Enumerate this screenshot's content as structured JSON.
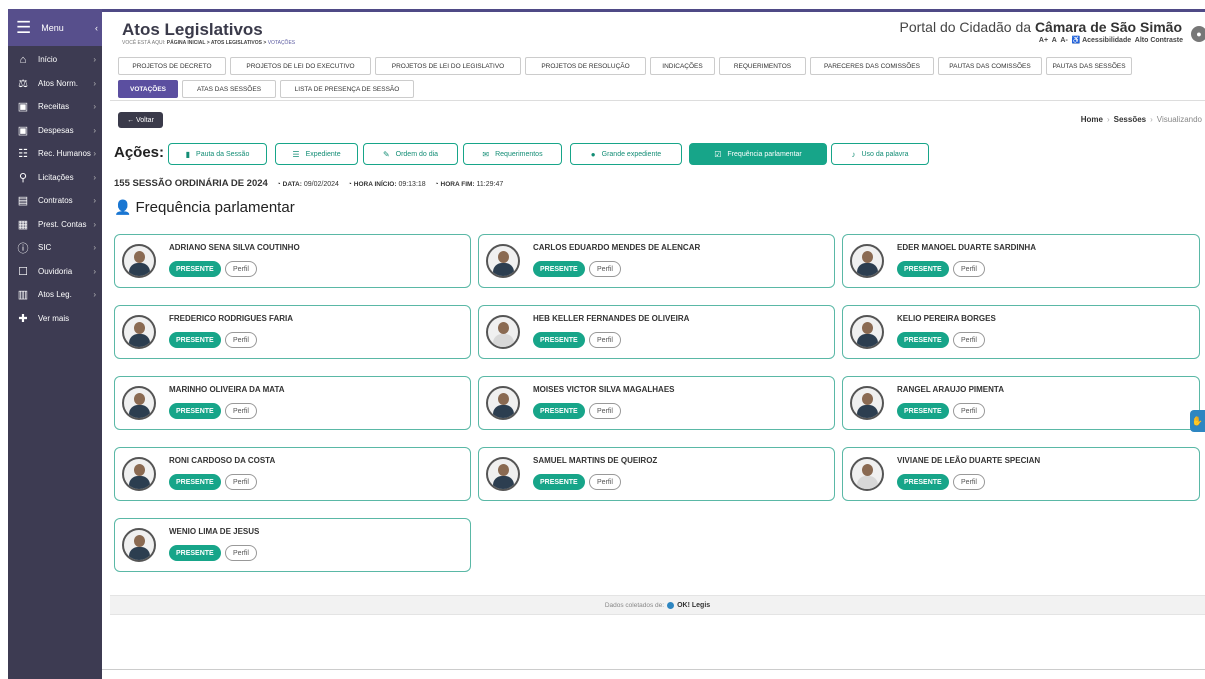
{
  "sidebar": {
    "menu_label": "Menu",
    "items": [
      {
        "label": "Início",
        "icon": "home-icon",
        "glyph": "⌂"
      },
      {
        "label": "Atos Norm.",
        "icon": "scales-icon",
        "glyph": "⚖"
      },
      {
        "label": "Receitas",
        "icon": "money-icon",
        "glyph": "▣"
      },
      {
        "label": "Despesas",
        "icon": "money-out-icon",
        "glyph": "▣"
      },
      {
        "label": "Rec. Humanos",
        "icon": "people-icon",
        "glyph": "☷"
      },
      {
        "label": "Licitações",
        "icon": "handshake-icon",
        "glyph": "⚲"
      },
      {
        "label": "Contratos",
        "icon": "document-icon",
        "glyph": "▤"
      },
      {
        "label": "Prest. Contas",
        "icon": "accounts-icon",
        "glyph": "▦"
      },
      {
        "label": "SIC",
        "icon": "info-icon",
        "glyph": "ⓘ"
      },
      {
        "label": "Ouvidoria",
        "icon": "chat-icon",
        "glyph": "☐"
      },
      {
        "label": "Atos Leg.",
        "icon": "building-icon",
        "glyph": "▥"
      },
      {
        "label": "Ver mais",
        "icon": "plus-icon",
        "glyph": "✚"
      }
    ]
  },
  "header": {
    "title": "Atos Legislativos",
    "breadcrumb_prefix": "VOCÊ ESTÁ AQUI:",
    "breadcrumb_path": "PÁGINA INICIAL > ATOS LEGISLATIVOS >",
    "breadcrumb_current": "VOTAÇÕES",
    "portal_prefix": "Portal do Cidadão da",
    "portal_name": "Câmara de São Simão",
    "font_up": "A+",
    "font_normal": "A",
    "font_down": "A-",
    "accessibility": "Acessibilidade",
    "high_contrast": "Alto Contraste"
  },
  "tabs_row1": [
    "PROJETOS DE DECRETO",
    "PROJETOS DE LEI DO EXECUTIVO",
    "PROJETOS DE LEI DO LEGISLATIVO",
    "PROJETOS DE RESOLUÇÃO",
    "INDICAÇÕES",
    "REQUERIMENTOS",
    "PARECERES DAS COMISSÕES",
    "PAUTAS DAS COMISSÕES",
    "PAUTAS DAS SESSÕES"
  ],
  "tabs_row2": [
    "VOTAÇÕES",
    "ATAS DAS SESSÕES",
    "LISTA DE PRESENÇA DE SESSÃO"
  ],
  "back_label": "← Voltar",
  "breadcrumb": {
    "home": "Home",
    "sessoes": "Sessões",
    "current": "Visualizando"
  },
  "actions": {
    "title": "Ações:",
    "buttons": [
      {
        "label": "Pauta da Sessão",
        "glyph": "▮"
      },
      {
        "label": "Expediente",
        "glyph": "☰"
      },
      {
        "label": "Ordem do dia",
        "glyph": "✎"
      },
      {
        "label": "Requerimentos",
        "glyph": "✉"
      },
      {
        "label": "Grande expediente",
        "glyph": "●"
      },
      {
        "label": "Frequência parlamentar",
        "glyph": "☑"
      },
      {
        "label": "Uso da palavra",
        "glyph": "♪"
      }
    ]
  },
  "session": {
    "title": "155 SESSÃO ORDINÁRIA DE 2024",
    "date_label": "DATA:",
    "date": "09/02/2024",
    "start_label": "HORA INÍCIO:",
    "start": "09:13:18",
    "end_label": "HORA FIM:",
    "end": "11:29:47"
  },
  "section_title": "Frequência parlamentar",
  "status_label": "PRESENTE",
  "profile_label": "Perfil",
  "members": [
    {
      "name": "ADRIANO SENA SILVA COUTINHO"
    },
    {
      "name": "CARLOS EDUARDO MENDES DE ALENCAR"
    },
    {
      "name": "EDER MANOEL DUARTE SARDINHA"
    },
    {
      "name": "FREDERICO RODRIGUES FARIA"
    },
    {
      "name": "HEB KELLER FERNANDES DE OLIVEIRA"
    },
    {
      "name": "KELIO PEREIRA BORGES"
    },
    {
      "name": "MARINHO OLIVEIRA DA MATA"
    },
    {
      "name": "MOISES VICTOR SILVA MAGALHAES"
    },
    {
      "name": "RANGEL ARAUJO PIMENTA"
    },
    {
      "name": "RONI CARDOSO DA COSTA"
    },
    {
      "name": "SAMUEL MARTINS DE QUEIROZ"
    },
    {
      "name": "VIVIANE DE LEÃO DUARTE SPECIAN"
    },
    {
      "name": "WENIO LIMA DE JESUS"
    }
  ],
  "footer": {
    "prefix": "Dados coletados de:",
    "brand": "OK! Legis"
  },
  "colors": {
    "primary": "#5b4fa0",
    "accent": "#17a589",
    "sidebar": "#3d3b52"
  }
}
